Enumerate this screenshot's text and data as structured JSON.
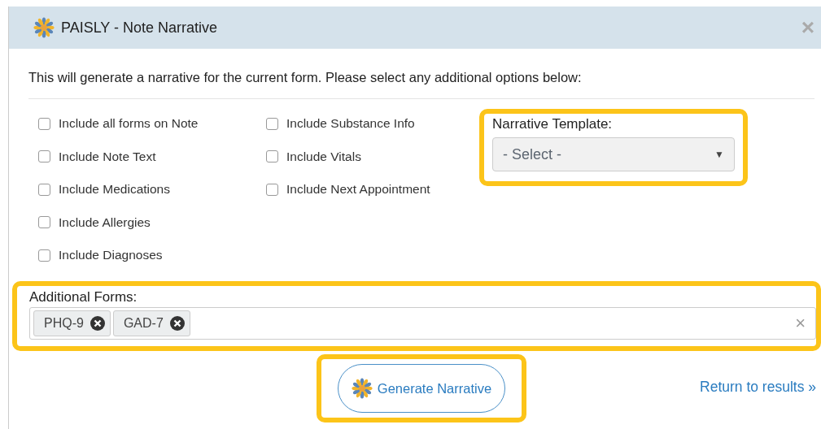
{
  "window": {
    "title": "PAISLY - Note Narrative",
    "close": "×"
  },
  "intro": "This will generate a narrative for the current form. Please select any additional options below:",
  "options": [
    {
      "label": "Include all forms on Note",
      "checked": false
    },
    {
      "label": "Include Note Text",
      "checked": false
    },
    {
      "label": "Include Medications",
      "checked": false
    },
    {
      "label": "Include Allergies",
      "checked": false
    },
    {
      "label": "Include Diagnoses",
      "checked": false
    },
    {
      "label": "Include Substance Info",
      "checked": false
    },
    {
      "label": "Include Vitals",
      "checked": false
    },
    {
      "label": "Include Next Appointment",
      "checked": false
    }
  ],
  "template": {
    "label": "Narrative Template:",
    "value": "- Select -",
    "caret": "▼",
    "highlighted": true
  },
  "additional_forms": {
    "label": "Additional Forms:",
    "tags": [
      "PHQ-9",
      "GAD-7"
    ],
    "clear": "×",
    "highlighted": true
  },
  "generate_button": {
    "label": "Generate Narrative",
    "highlighted": true
  },
  "return_link": "Return to results »"
}
